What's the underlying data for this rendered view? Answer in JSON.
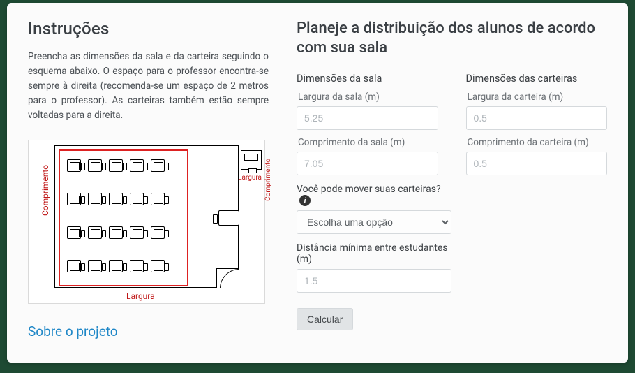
{
  "instructions": {
    "title": "Instruções",
    "body": "Preencha as dimensões da sala e da carteira seguindo o esquema abaixo. O espaço para o professor encontra-se sempre à direita (recomenda-se um espaço de 2 metros para o professor). As carteiras também estão sempre voltadas para a direita."
  },
  "about_link": "Sobre o projeto",
  "diagram": {
    "comprimento": "Comprimento",
    "largura": "Largura",
    "comprimento2": "Comprimento",
    "largura2": "Largura"
  },
  "plan": {
    "title": "Planeje a distribuição dos alunos de acordo com sua sala",
    "room_section": "Dimensões da sala",
    "desk_section": "Dimensões das carteiras",
    "room_width_label": "Largura da sala (m)",
    "room_width_placeholder": "5.25",
    "room_length_label": "Comprimento da sala (m)",
    "room_length_placeholder": "7.05",
    "desk_width_label": "Largura da carteira (m)",
    "desk_width_placeholder": "0.5",
    "desk_length_label": "Comprimento da carteira (m)",
    "desk_length_placeholder": "0.5",
    "move_question": "Você pode mover suas carteiras?",
    "move_placeholder": "Escolha uma opção",
    "distance_label": "Distância mínima entre estudantes (m)",
    "distance_placeholder": "1.5",
    "calc_button": "Calcular"
  }
}
